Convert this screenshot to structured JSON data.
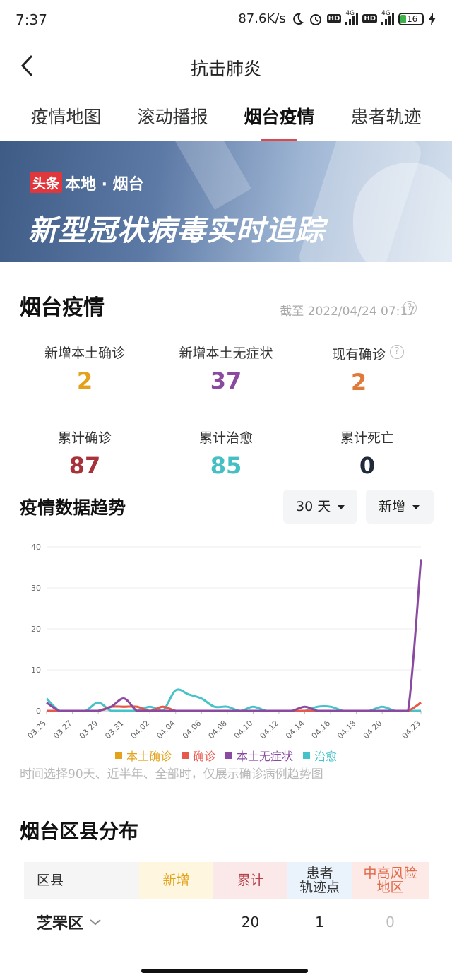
{
  "status_bar": {
    "time": "7:37",
    "speed": "87.6K/s",
    "battery": "16",
    "network1": "4G",
    "network2": "4G",
    "hd": "HD"
  },
  "nav": {
    "title": "抗击肺炎"
  },
  "tabs": [
    {
      "label": "疫情地图",
      "active": false
    },
    {
      "label": "滚动播报",
      "active": false
    },
    {
      "label": "烟台疫情",
      "active": true
    },
    {
      "label": "患者轨迹",
      "active": false
    }
  ],
  "banner": {
    "badge": "头条",
    "local": "本地 · 烟台",
    "title": "新型冠状病毒实时追踪"
  },
  "overview": {
    "title": "烟台疫情",
    "as_of": "截至 2022/04/24 07:17",
    "stats": [
      {
        "label": "新增本土确诊",
        "value": "2",
        "color": "#e3a21a"
      },
      {
        "label": "新增本土无症状",
        "value": "37",
        "color": "#8a4aa0"
      },
      {
        "label": "现有确诊",
        "value": "2",
        "color": "#e07a3a"
      },
      {
        "label": "累计确诊",
        "value": "87",
        "color": "#a8323a"
      },
      {
        "label": "累计治愈",
        "value": "85",
        "color": "#45bfc4"
      },
      {
        "label": "累计死亡",
        "value": "0",
        "color": "#1f2a3a"
      }
    ]
  },
  "trend": {
    "title": "疫情数据趋势",
    "range_select": "30 天",
    "mode_select": "新增",
    "note": "时间选择90天、近半年、全部时，仅展示确诊病例趋势图"
  },
  "chart_data": {
    "type": "line",
    "categories": [
      "03.25",
      "03.26",
      "03.27",
      "03.28",
      "03.29",
      "03.30",
      "03.31",
      "04.01",
      "04.02",
      "04.03",
      "04.04",
      "04.05",
      "04.06",
      "04.07",
      "04.08",
      "04.09",
      "04.10",
      "04.11",
      "04.12",
      "04.13",
      "04.14",
      "04.15",
      "04.16",
      "04.17",
      "04.18",
      "04.19",
      "04.20",
      "04.21",
      "04.22",
      "04.23"
    ],
    "x_tick_labels": [
      "03.25",
      "03.27",
      "03.29",
      "03.31",
      "04.02",
      "04.04",
      "04.06",
      "04.08",
      "04.10",
      "04.12",
      "04.14",
      "04.16",
      "04.18",
      "04.20",
      "04.23"
    ],
    "ylim": [
      0,
      40
    ],
    "y_ticks": [
      0,
      10,
      20,
      30,
      40
    ],
    "grid": true,
    "legend_position": "bottom",
    "series": [
      {
        "name": "本土确诊",
        "color": "#e3a21a",
        "values": [
          0,
          0,
          0,
          0,
          0,
          1,
          1,
          1,
          0,
          1,
          0,
          0,
          0,
          0,
          0,
          0,
          0,
          0,
          0,
          0,
          0,
          0,
          0,
          0,
          0,
          0,
          0,
          0,
          0,
          2
        ]
      },
      {
        "name": "确诊",
        "color": "#e8574b",
        "values": [
          0,
          0,
          0,
          0,
          0,
          1,
          1,
          1,
          0,
          1,
          0,
          0,
          0,
          0,
          0,
          0,
          0,
          0,
          0,
          0,
          0,
          0,
          0,
          0,
          0,
          0,
          0,
          0,
          0,
          2
        ]
      },
      {
        "name": "本土无症状",
        "color": "#8a4aa0",
        "values": [
          2,
          0,
          0,
          0,
          0,
          1,
          3,
          0,
          0,
          0,
          0,
          0,
          0,
          0,
          0,
          0,
          0,
          0,
          0,
          0,
          1,
          0,
          0,
          0,
          0,
          0,
          0,
          0,
          0,
          37
        ]
      },
      {
        "name": "治愈",
        "color": "#45c3c9",
        "values": [
          3,
          0,
          0,
          0,
          2,
          0,
          0,
          0,
          1,
          0,
          5,
          4,
          3,
          1,
          1,
          0,
          1,
          0,
          0,
          0,
          0,
          1,
          1,
          0,
          0,
          0,
          1,
          0,
          0,
          0
        ]
      }
    ]
  },
  "districts": {
    "title": "烟台区县分布",
    "headers": {
      "district": "区县",
      "new": "新增",
      "total": "累计",
      "track_line1": "患者",
      "track_line2": "轨迹点",
      "risk_line1": "中高风险",
      "risk_line2": "地区"
    },
    "rows": [
      {
        "name": "芝罘区",
        "new": "",
        "total": "20",
        "track": "1",
        "risk": "0"
      }
    ]
  }
}
